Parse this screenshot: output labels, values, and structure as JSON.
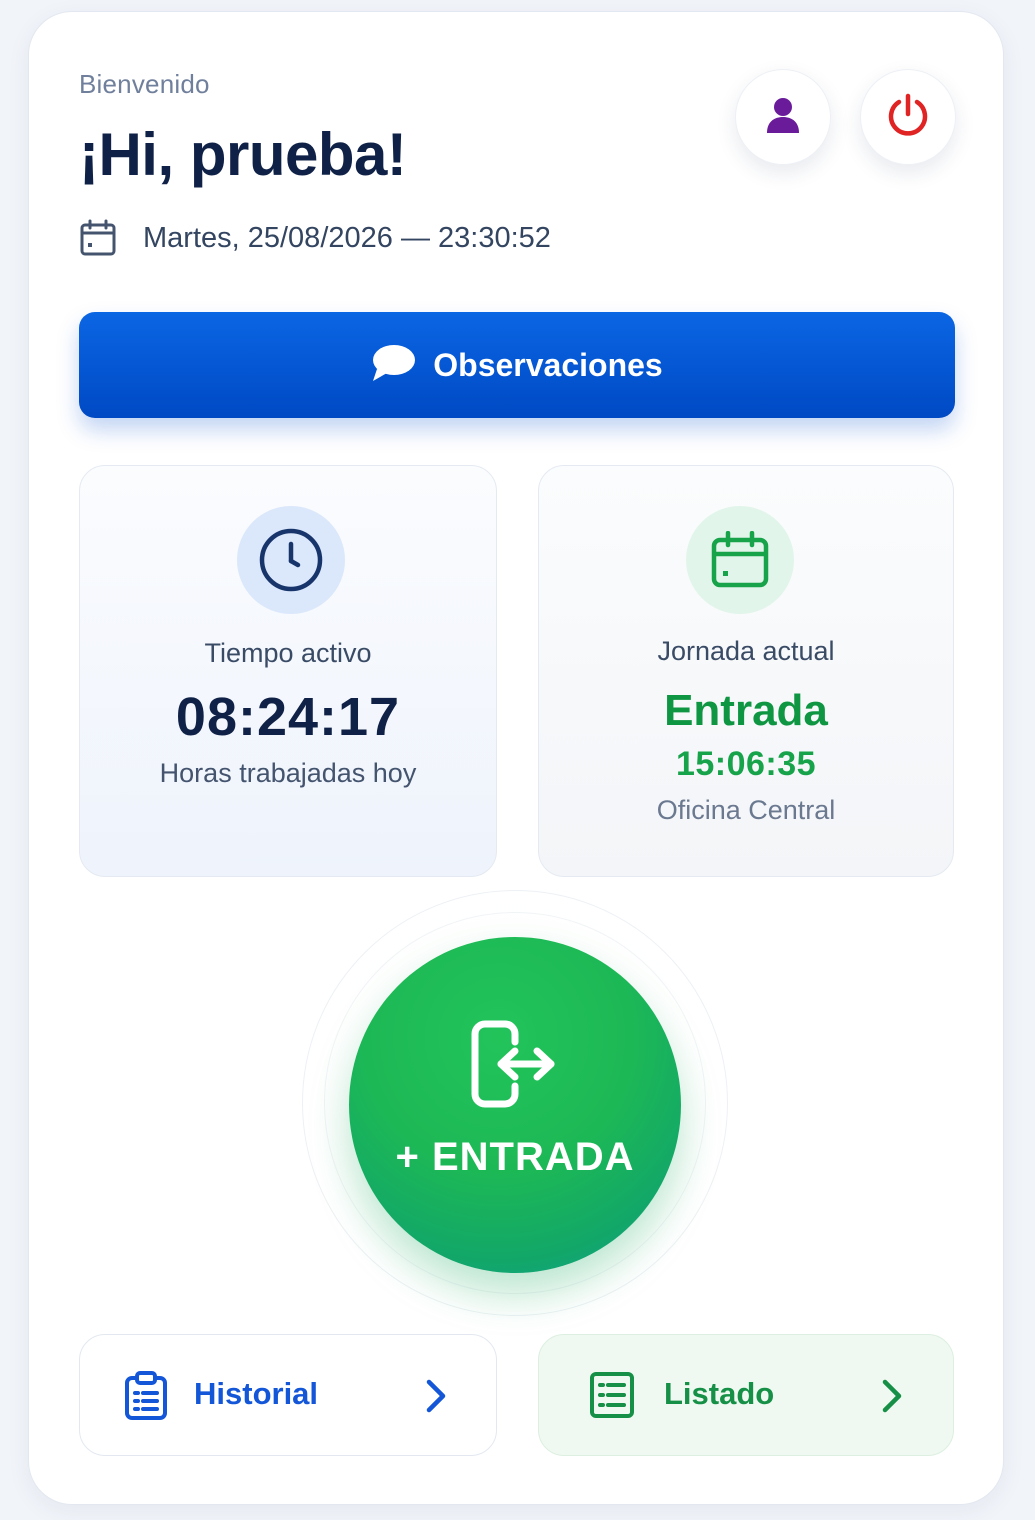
{
  "header": {
    "welcome": "Bienvenido",
    "greeting": "¡Hi, prueba!",
    "datetime": "Martes, 25/08/2026 — 23:30:52",
    "profile_icon": "user-icon",
    "power_icon": "power-icon"
  },
  "observaciones": {
    "label": "Observaciones",
    "icon": "chat-bubble-icon"
  },
  "tiempo_activo": {
    "title": "Tiempo activo",
    "value": "08:24:17",
    "subtitle": "Horas trabajadas hoy",
    "icon": "clock-icon"
  },
  "jornada_actual": {
    "title": "Jornada actual",
    "status": "Entrada",
    "time": "15:06:35",
    "location": "Oficina Central",
    "icon": "calendar-icon"
  },
  "main_action": {
    "label": "+ ENTRADA",
    "icon": "sign-in-icon"
  },
  "nav": {
    "historial": {
      "label": "Historial",
      "icon": "clipboard-icon"
    },
    "listado": {
      "label": "Listado",
      "icon": "list-icon"
    }
  },
  "colors": {
    "primary_blue": "#0b5fe0",
    "green": "#17a34a",
    "dark_text": "#0f2146",
    "power_red": "#e02424",
    "profile_purple": "#6a1b9a"
  }
}
